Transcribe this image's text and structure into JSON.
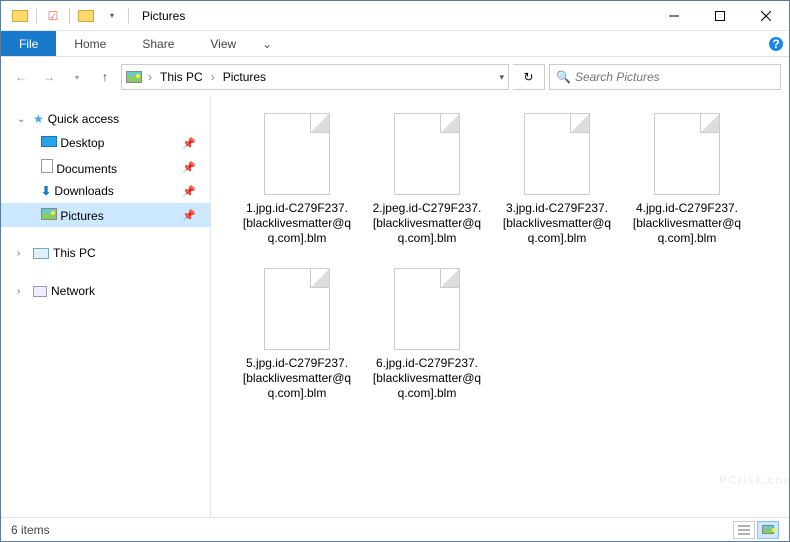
{
  "window": {
    "title": "Pictures"
  },
  "ribbon": {
    "file": "File",
    "tabs": [
      "Home",
      "Share",
      "View"
    ]
  },
  "breadcrumb": {
    "root": "This PC",
    "current": "Pictures"
  },
  "search": {
    "placeholder": "Search Pictures"
  },
  "sidebar": {
    "quick_access": "Quick access",
    "items": [
      {
        "label": "Desktop"
      },
      {
        "label": "Documents"
      },
      {
        "label": "Downloads"
      },
      {
        "label": "Pictures"
      }
    ],
    "this_pc": "This PC",
    "network": "Network"
  },
  "files": [
    {
      "name": "1.jpg.id-C279F237.[blacklivesmatter@qq.com].blm"
    },
    {
      "name": "2.jpeg.id-C279F237.[blacklivesmatter@qq.com].blm"
    },
    {
      "name": "3.jpg.id-C279F237.[blacklivesmatter@qq.com].blm"
    },
    {
      "name": "4.jpg.id-C279F237.[blacklivesmatter@qq.com].blm"
    },
    {
      "name": "5.jpg.id-C279F237.[blacklivesmatter@qq.com].blm"
    },
    {
      "name": "6.jpg.id-C279F237.[blacklivesmatter@qq.com].blm"
    }
  ],
  "status": {
    "count": "6 items"
  },
  "watermark": {
    "main": "PCrisk.com",
    "sub": ""
  }
}
